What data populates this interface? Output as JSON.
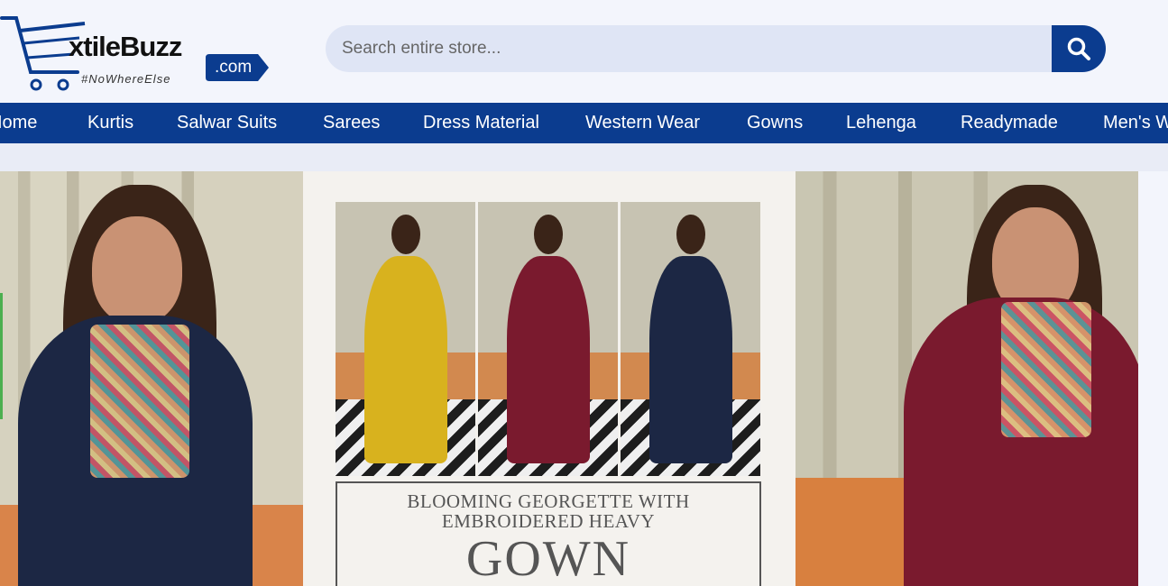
{
  "logo": {
    "name": "xtileBuzz",
    "tagline": "#NoWhereElse",
    "domain": ".com",
    "icon": "shopping-cart-icon"
  },
  "search": {
    "placeholder": "Search entire store...",
    "button_icon": "search-icon"
  },
  "nav": {
    "items": [
      {
        "label": "Home"
      },
      {
        "label": "Kurtis"
      },
      {
        "label": "Salwar Suits"
      },
      {
        "label": "Sarees"
      },
      {
        "label": "Dress Material"
      },
      {
        "label": "Western Wear"
      },
      {
        "label": "Gowns"
      },
      {
        "label": "Lehenga"
      },
      {
        "label": "Readymade"
      },
      {
        "label": "Men's Wear"
      }
    ]
  },
  "banner": {
    "line1": "BLOOMING GEORGETTE WITH",
    "line2": "EMBROIDERED HEAVY",
    "line3": "GOWN"
  },
  "colors": {
    "brand_blue": "#0b3c8f",
    "page_bg": "#f3f5fc",
    "search_bg": "#dfe5f5"
  }
}
